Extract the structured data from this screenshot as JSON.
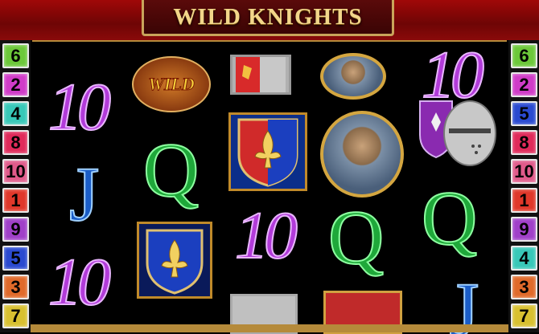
{
  "title": "WILD KNIGHTS",
  "left_paylines": [
    "6",
    "2",
    "4",
    "8",
    "10",
    "1",
    "9",
    "5",
    "3",
    "7"
  ],
  "right_paylines": [
    "6",
    "2",
    "5",
    "8",
    "10",
    "1",
    "9",
    "4",
    "3",
    "7"
  ],
  "payline_colors": {
    "6": "#6cc83a",
    "2": "#d03cc8",
    "4": "#38c8b8",
    "8": "#e02a5a",
    "10": "#e05a8a",
    "1": "#e0382a",
    "9": "#a040c8",
    "5": "#2a4ad0",
    "3": "#e06a2a",
    "7": "#d8c030"
  },
  "symbols": {
    "ten": "10",
    "queen": "Q",
    "jack": "J",
    "wild": "WILD"
  }
}
